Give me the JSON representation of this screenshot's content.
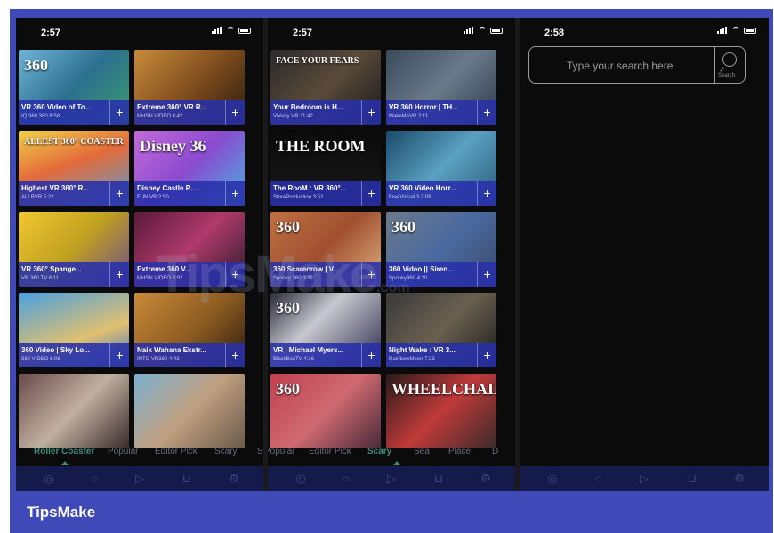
{
  "brand": "TipsMake",
  "watermark": "TipsMake",
  "watermark_suffix": ".com",
  "screens": [
    {
      "time": "2:57",
      "cards": [
        {
          "title": "VR 360 Video of To...",
          "sub": "IQ 360 360   8:58",
          "art": "360",
          "bg": "linear-gradient(135deg,#6fb5d8,#2d6f8f 50%,#3a9f6d)"
        },
        {
          "title": "Extreme 360° VR R...",
          "sub": "MHSN VIDEO   4:42",
          "art": "",
          "bg": "linear-gradient(135deg,#c98a3a,#7a4a1c 55%,#2a1a10)"
        },
        {
          "title": "Highest VR 360° R...",
          "sub": "ALLRVR   5:22",
          "art": "ALLEST 360° COASTER",
          "bg": "linear-gradient(160deg,#f2d34a,#e36a3a 45%,#5aa0d0)"
        },
        {
          "title": "Disney Castle R...",
          "sub": "FUN VR   2:50",
          "art": "Disney 36",
          "bg": "linear-gradient(135deg,#c46ad8,#8a4bd0 50%,#4ab0e0)"
        },
        {
          "title": "VR 360° Spange...",
          "sub": "VR 360 TV   6:11",
          "art": "",
          "bg": "linear-gradient(135deg,#f0c830,#c0a020 50%,#6a4a8a)"
        },
        {
          "title": "Extreme 360 V...",
          "sub": "MHSN VIDEO   3:02",
          "art": "",
          "bg": "linear-gradient(135deg,#5a1a3a,#b03a6a 50%,#2a1a2a)"
        },
        {
          "title": "360 Video | Sky Lo...",
          "sub": "360 VIDEO   6:08",
          "art": "",
          "bg": "linear-gradient(160deg,#4aa0e0,#e0c070 60%,#3a6ad0)"
        },
        {
          "title": "Naik Wahana Ekstr...",
          "sub": "INTO VR360   4:43",
          "art": "",
          "bg": "linear-gradient(135deg,#c98a3a,#8a5a20 55%,#2a1a10)"
        },
        {
          "title": "",
          "sub": "",
          "art": "",
          "bg": "linear-gradient(135deg,#6a4a4a,#c0b0a0 50%,#3a2a2a)"
        },
        {
          "title": "",
          "sub": "",
          "art": "",
          "bg": "linear-gradient(135deg,#7ab0d0,#c0a080 50%,#6a5a4a)"
        }
      ],
      "tabs": [
        "Roller Coaster",
        "Popular",
        "Editor Pick",
        "Scary",
        "S"
      ],
      "active_tab": "Roller Coaster"
    },
    {
      "time": "2:57",
      "cards": [
        {
          "title": "Your Bedroom is H...",
          "sub": "Vivivity VR   11:42",
          "art": "FACE YOUR FEARS",
          "bg": "linear-gradient(135deg,#2a2a2a,#5a4a3a 50%,#1a1a1a)"
        },
        {
          "title": "VR 360 Horror | TH...",
          "sub": "MakeMeVR   2:11",
          "art": "",
          "bg": "linear-gradient(135deg,#3a4a5a,#6a7a8a 50%,#2a3a4a)"
        },
        {
          "title": "The RooM : VR 360°...",
          "sub": "StoreProduction   3:52",
          "art": "THE ROOM",
          "bg": "linear-gradient(180deg,#0a0a0a,#1a1a1a)"
        },
        {
          "title": "VR 360 Video Horr...",
          "sub": "FreeVirtual 3   2:08",
          "art": "",
          "bg": "linear-gradient(135deg,#1a4a6a,#5aa0c0 50%,#2a5a7a)"
        },
        {
          "title": "360 Scarecrow | V...",
          "sub": "Spooky 360   3:11",
          "art": "360",
          "bg": "linear-gradient(135deg,#c07040,#a05030 50%,#e0b080)"
        },
        {
          "title": "360 Video || Siren...",
          "sub": "Spooky360   4:20",
          "art": "360",
          "bg": "linear-gradient(135deg,#6a7a8a,#4a6aa0 50%,#3a4a6a)"
        },
        {
          "title": "VR | Michael Myers...",
          "sub": "BlackBoxTV   4:16",
          "art": "360",
          "bg": "linear-gradient(135deg,#2a2a3a,#c8c8d0 40%,#2a2a4a)"
        },
        {
          "title": "Night Wake : VR 3...",
          "sub": "RainbowMoon   7:23",
          "art": "",
          "bg": "linear-gradient(135deg,#3a3a3a,#6a6050 50%,#1a1a1a)"
        },
        {
          "title": "",
          "sub": "",
          "art": "360",
          "bg": "linear-gradient(135deg,#c04050,#d06a70 50%,#4a2a3a)"
        },
        {
          "title": "",
          "sub": "",
          "art": "WHEELCHAIR",
          "bg": "linear-gradient(135deg,#2a1a1a,#c03a3a 50%,#3a2a2a)"
        }
      ],
      "tabs": [
        "Popular",
        "Editor Pick",
        "Scary",
        "Sea",
        "Place",
        "D"
      ],
      "active_tab": "Scary"
    },
    {
      "time": "2:58",
      "search_placeholder": "Type your search here",
      "search_button_label": "Search"
    }
  ],
  "nav_icons": [
    "home-icon",
    "search-icon",
    "play-icon",
    "cart-icon",
    "settings-icon"
  ]
}
